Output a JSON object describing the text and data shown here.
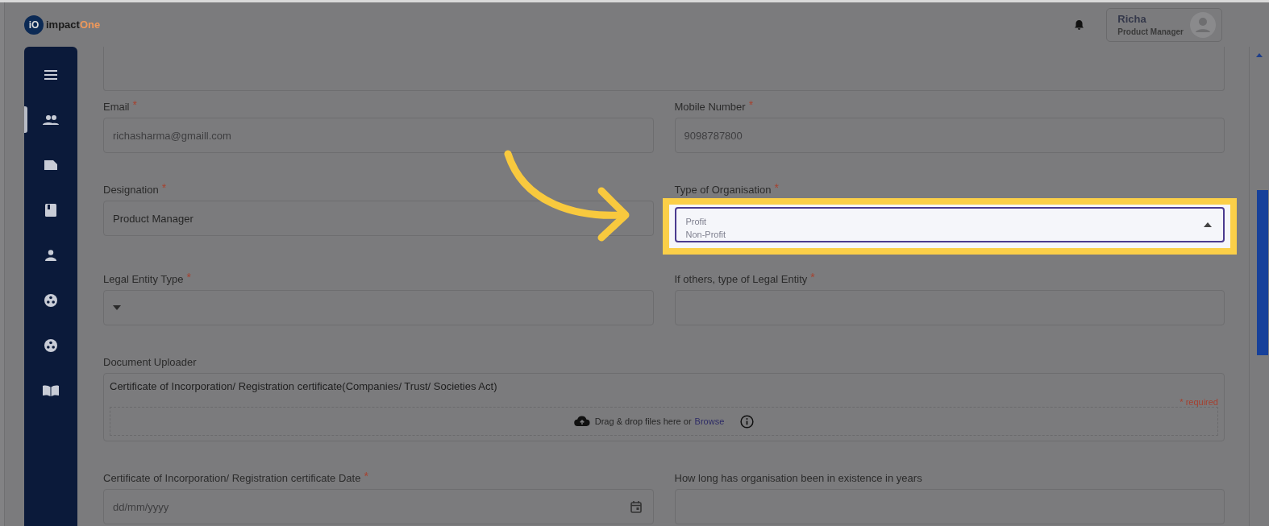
{
  "header": {
    "logo_mark": "iO",
    "logo_text": "impact",
    "logo_accent": "One",
    "user": {
      "name": "Richa",
      "role": "Product Manager"
    }
  },
  "sidebar": {
    "items": [
      {
        "kind": "menu",
        "selected": false
      },
      {
        "kind": "people",
        "selected": true
      },
      {
        "kind": "tag",
        "selected": false
      },
      {
        "kind": "book",
        "selected": false
      },
      {
        "kind": "person",
        "selected": false
      },
      {
        "kind": "reel",
        "selected": false
      },
      {
        "kind": "reel",
        "selected": false
      },
      {
        "kind": "open-book",
        "selected": false
      }
    ]
  },
  "form": {
    "fields": [
      {
        "kind": "textarea"
      },
      {
        "kind": "text",
        "label": "Email",
        "required_mark": "*",
        "value": "richasharma@gmaill.com",
        "disabled": true
      },
      {
        "kind": "text",
        "label": "Mobile Number",
        "required_mark": "*",
        "value": "9098787800",
        "disabled": true
      },
      {
        "kind": "text",
        "label": "Designation",
        "required_mark": "*",
        "value": "Product Manager",
        "disabled": false
      },
      {
        "kind": "select",
        "label": "Type of Organisation",
        "required_mark": "*",
        "open": true,
        "highlighted": true,
        "options": [
          "Profit",
          "Non-Profit"
        ]
      },
      {
        "kind": "select",
        "label": "Legal Entity Type",
        "required_mark": "*",
        "open": false
      },
      {
        "kind": "text",
        "label": "If others, type of Legal Entity",
        "required_mark": "*"
      },
      {
        "kind": "upload",
        "label": "Document Uploader",
        "document": "Certificate of Incorporation/ Registration certificate(Companies/ Trust/ Societies Act)",
        "note": "* required",
        "drop_text": "Drag & drop files here or",
        "link": "Browse"
      },
      {
        "kind": "date",
        "label": "Certificate of Incorporation/ Registration certificate Date",
        "required_mark": "*",
        "placeholder": "dd/mm/yyyy"
      },
      {
        "kind": "text",
        "label": "How long has organisation been in existence in years"
      }
    ]
  }
}
